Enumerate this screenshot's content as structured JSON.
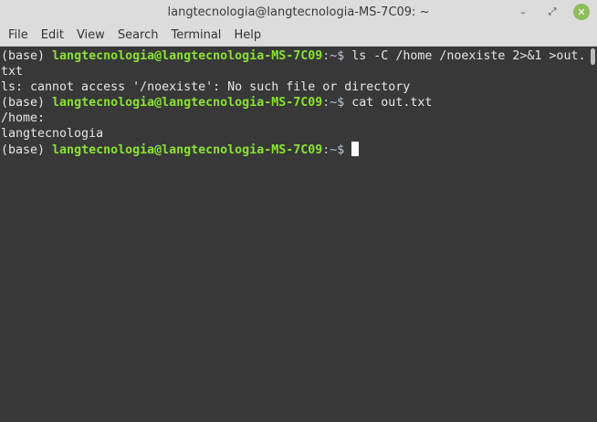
{
  "window": {
    "title": "langtecnologia@langtecnologia-MS-7C09: ~",
    "controls": {
      "minimize": "–",
      "maximize": "⤢",
      "close": "✕"
    }
  },
  "menu": [
    "File",
    "Edit",
    "View",
    "Search",
    "Terminal",
    "Help"
  ],
  "terminal": {
    "lines": [
      {
        "env": "(base) ",
        "user": "langtecnologia@langtecnologia-MS-7C09",
        "path": ":~$ ",
        "cmd": "ls -C /home /noexiste 2>&1 >out."
      },
      {
        "text": "txt"
      },
      {
        "text": "ls: cannot access '/noexiste': No such file or directory"
      },
      {
        "env": "(base) ",
        "user": "langtecnologia@langtecnologia-MS-7C09",
        "path": ":~$ ",
        "cmd": "cat out.txt"
      },
      {
        "text": "/home:"
      },
      {
        "text": "langtecnologia"
      },
      {
        "env": "(base) ",
        "user": "langtecnologia@langtecnologia-MS-7C09",
        "path": ":~$ ",
        "cmd": ""
      }
    ]
  },
  "colors": {
    "user": "#8ae234",
    "path": "#b7c7e0",
    "background": "#383838"
  }
}
